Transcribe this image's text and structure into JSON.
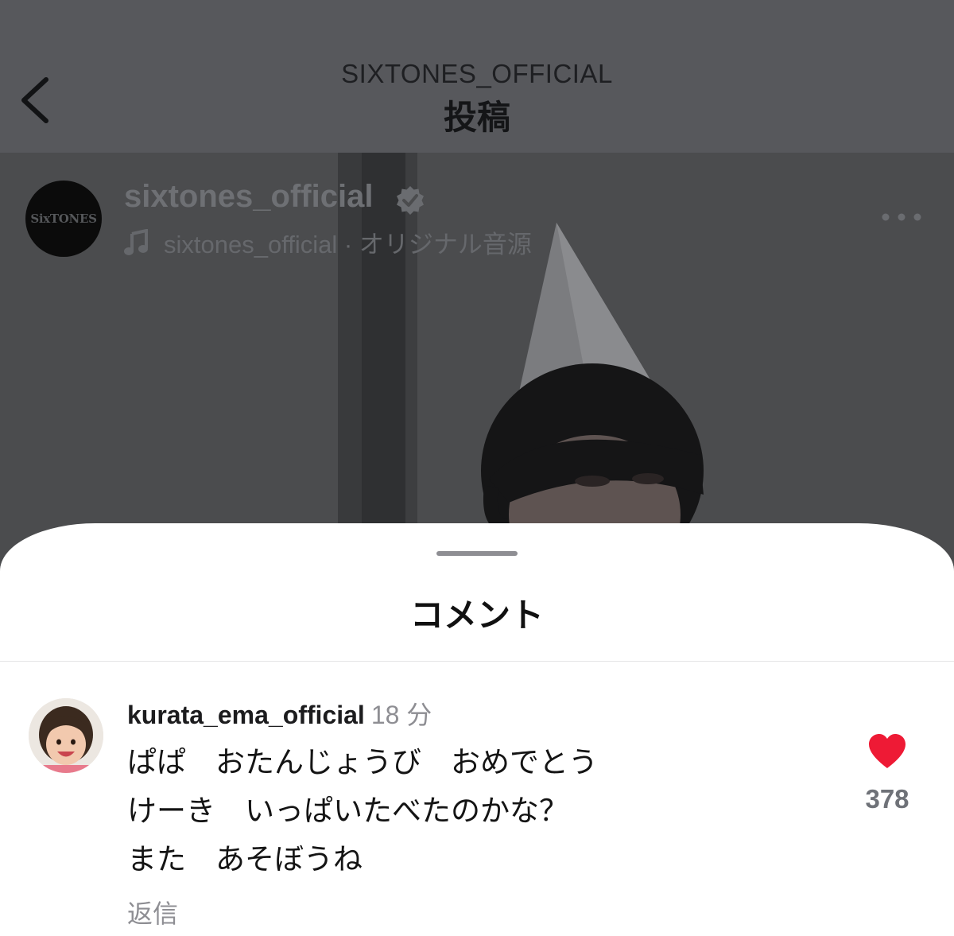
{
  "header": {
    "username": "SIXTONES_OFFICIAL",
    "title": "投稿",
    "back_icon": "chevron-left-icon"
  },
  "post": {
    "author_avatar_text": "SixTONES",
    "username": "sixtones_official",
    "verified_icon": "verified-badge-icon",
    "music_icon": "music-note-icon",
    "music_label": "sixtones_official · オリジナル音源",
    "more_icon": "more-horizontal-icon"
  },
  "comments_sheet": {
    "title": "コメント",
    "comments": [
      {
        "username": "kurata_ema_official",
        "time": "18 分",
        "lines": [
          "ぱぱ　おたんじょうび　おめでとう",
          "けーき　いっぱいたべたのかな？",
          "また　あそぼうね"
        ],
        "reply_label": "返信",
        "liked": true,
        "like_count": "378"
      }
    ]
  },
  "colors": {
    "header_bg": "#57585c",
    "post_dim_bg": "#4b4c4e",
    "sheet_bg": "#ffffff",
    "like_red": "#ee1a35",
    "muted_text": "#8e8e93"
  }
}
